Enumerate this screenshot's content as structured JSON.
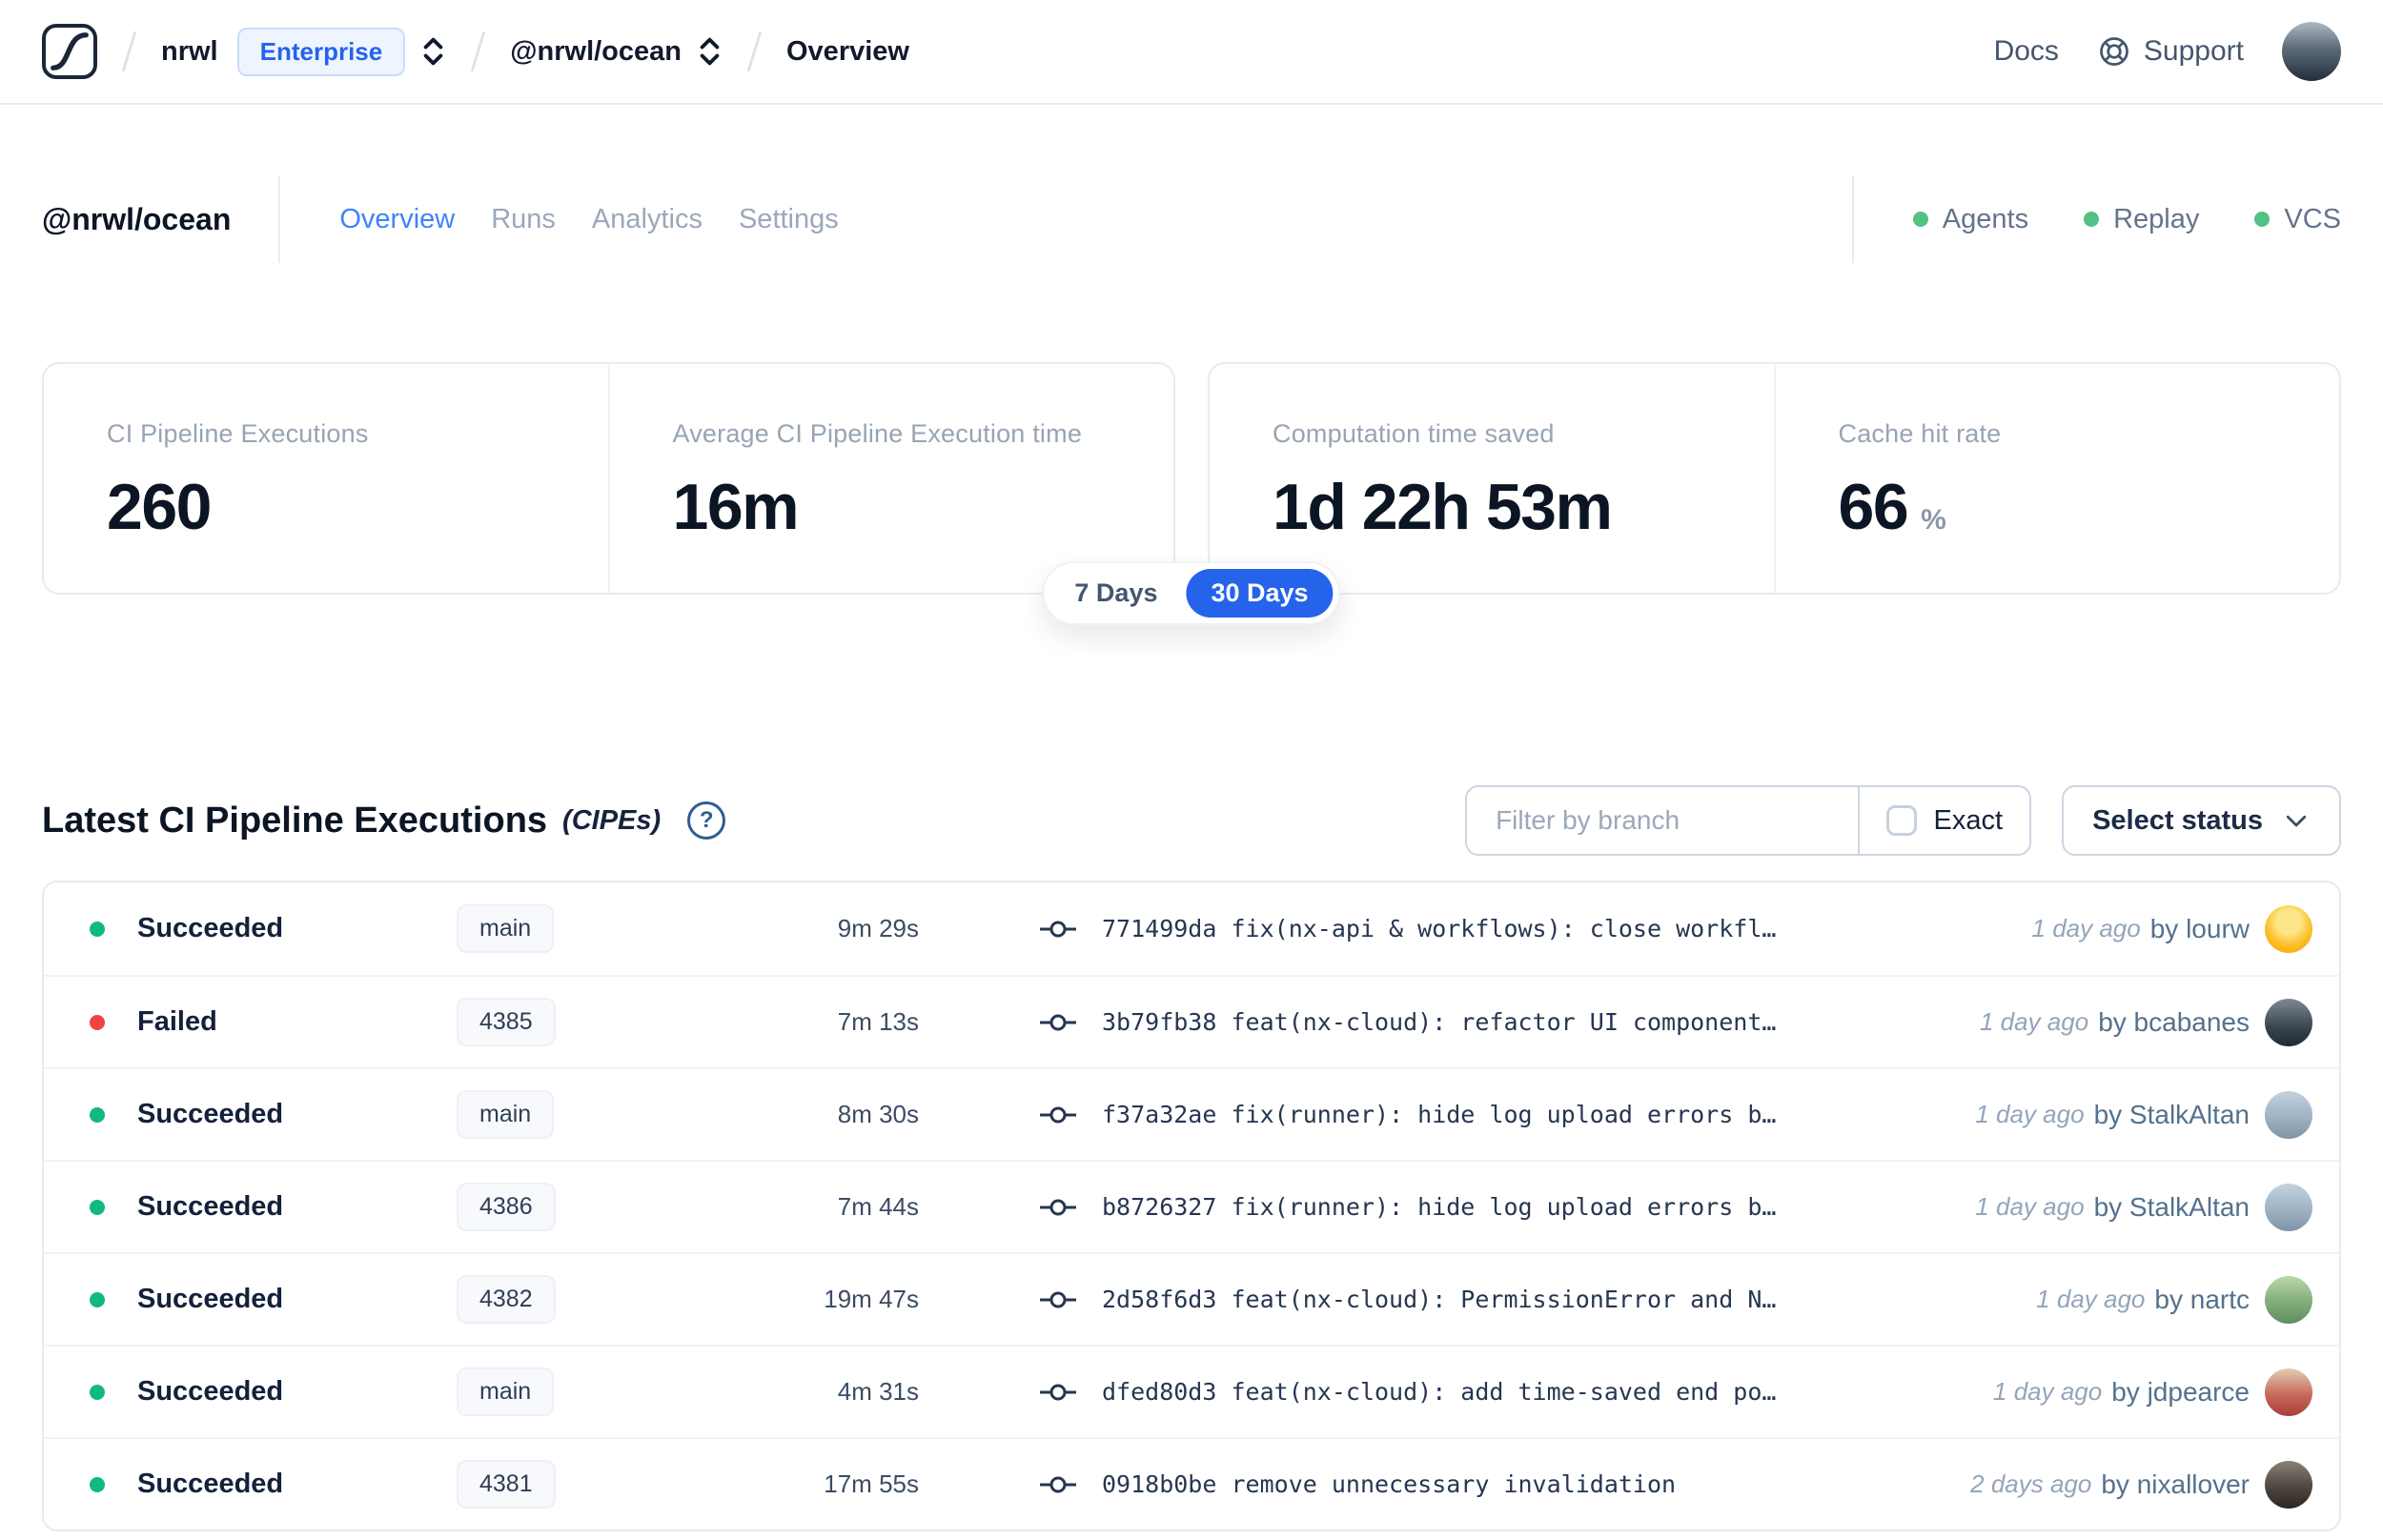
{
  "topbar": {
    "breadcrumb": {
      "org": "nrwl",
      "org_badge": "Enterprise",
      "workspace": "@nrwl/ocean",
      "page": "Overview"
    },
    "docs_label": "Docs",
    "support_label": "Support",
    "avatar_css": "background:linear-gradient(180deg,#aeb9c4 0%,#5d6b79 45%,#232e3a 100%)"
  },
  "header": {
    "workspace_title": "@nrwl/ocean",
    "tabs": [
      {
        "label": "Overview",
        "active": true
      },
      {
        "label": "Runs",
        "active": false
      },
      {
        "label": "Analytics",
        "active": false
      },
      {
        "label": "Settings",
        "active": false
      }
    ],
    "services": [
      {
        "label": "Agents",
        "status_color": "#52c183"
      },
      {
        "label": "Replay",
        "status_color": "#52c183"
      },
      {
        "label": "VCS",
        "status_color": "#52c183"
      }
    ]
  },
  "stats": {
    "cards": [
      {
        "label": "CI Pipeline Executions",
        "value": "260"
      },
      {
        "label": "Average CI Pipeline Execution time",
        "value": "16m"
      },
      {
        "label": "Computation time saved",
        "value": "1d 22h 53m"
      },
      {
        "label": "Cache hit rate",
        "value": "66",
        "suffix": "%"
      }
    ],
    "range_toggle": {
      "options": [
        "7 Days",
        "30 Days"
      ],
      "selected": "30 Days",
      "selected_color": "#2563eb"
    }
  },
  "cipe_section": {
    "title": "Latest CI Pipeline Executions",
    "title_suffix": "(CIPEs)",
    "help_glyph": "?",
    "filter_placeholder": "Filter by branch",
    "exact_label": "Exact",
    "status_select_label": "Select status",
    "rows": [
      {
        "status": "Succeeded",
        "status_color": "#10b981",
        "branch": "main",
        "duration": "9m 29s",
        "commit_hash": "771499da",
        "commit_message": "fix(nx-api & workflows): close workfl…",
        "time_ago": "1 day ago",
        "author": "by lourw",
        "avatar_css": "background:radial-gradient(circle at 50% 35%,#fde68a 0 30%,#fbbf24 60%,#f59e0b 100%)"
      },
      {
        "status": "Failed",
        "status_color": "#ef4444",
        "branch": "4385",
        "duration": "7m 13s",
        "commit_hash": "3b79fb38",
        "commit_message": "feat(nx-cloud): refactor UI component…",
        "time_ago": "1 day ago",
        "author": "by bcabanes",
        "avatar_css": "background:linear-gradient(180deg,#7d8a96 0%,#39444f 60%,#222b33 100%)"
      },
      {
        "status": "Succeeded",
        "status_color": "#10b981",
        "branch": "main",
        "duration": "8m 30s",
        "commit_hash": "f37a32ae",
        "commit_message": "fix(runner): hide log upload errors b…",
        "time_ago": "1 day ago",
        "author": "by StalkAltan",
        "avatar_css": "background:linear-gradient(180deg,#c3d2df 0%,#9fb3c4 55%,#7e94a6 100%)"
      },
      {
        "status": "Succeeded",
        "status_color": "#10b981",
        "branch": "4386",
        "duration": "7m 44s",
        "commit_hash": "b8726327",
        "commit_message": "fix(runner): hide log upload errors b…",
        "time_ago": "1 day ago",
        "author": "by StalkAltan",
        "avatar_css": "background:linear-gradient(180deg,#c3d2df 0%,#9fb3c4 55%,#7e94a6 100%)"
      },
      {
        "status": "Succeeded",
        "status_color": "#10b981",
        "branch": "4382",
        "duration": "19m 47s",
        "commit_hash": "2d58f6d3",
        "commit_message": "feat(nx-cloud): PermissionError and N…",
        "time_ago": "1 day ago",
        "author": "by nartc",
        "avatar_css": "background:linear-gradient(180deg,#b9d8a8 0%,#87b07e 50%,#5f8d61 100%)"
      },
      {
        "status": "Succeeded",
        "status_color": "#10b981",
        "branch": "main",
        "duration": "4m 31s",
        "commit_hash": "dfed80d3",
        "commit_message": "feat(nx-cloud): add time-saved end po…",
        "time_ago": "1 day ago",
        "author": "by jdpearce",
        "avatar_css": "background:linear-gradient(180deg,#e3cdb6 0%,#c96a5a 55%,#a83f3a 100%)"
      },
      {
        "status": "Succeeded",
        "status_color": "#10b981",
        "branch": "4381",
        "duration": "17m 55s",
        "commit_hash": "0918b0be",
        "commit_message": "remove unnecessary invalidation",
        "time_ago": "2 days ago",
        "author": "by nixallover",
        "avatar_css": "background:linear-gradient(180deg,#8a8076 0%,#4a433c 60%,#2b2622 100%)"
      }
    ]
  }
}
